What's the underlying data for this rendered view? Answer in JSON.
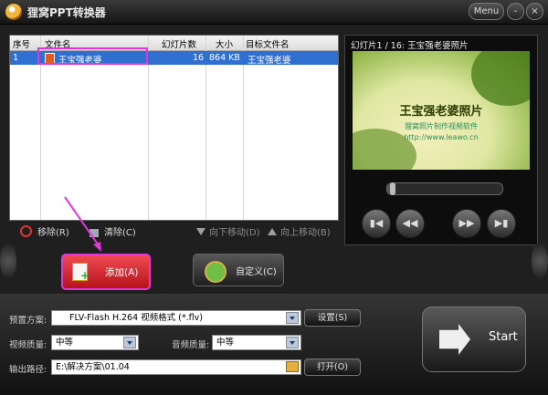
{
  "window": {
    "title": "狸窝PPT转换器",
    "menu_label": "Menu",
    "minimize_label": "-",
    "close_label": "×"
  },
  "file_table": {
    "headers": [
      "序号",
      "文件名",
      "幻灯片数",
      "大小",
      "目标文件名"
    ],
    "rows": [
      {
        "index": "1",
        "filename": "王宝强老婆",
        "slides": "16",
        "size": "864 KB",
        "target": "王宝强老婆"
      }
    ]
  },
  "preview": {
    "caption": "幻灯片1 / 16: 王宝强老婆照片",
    "slide_title": "王宝强老婆照片",
    "slide_subtitle": "狸窝照片制作视频软件",
    "slide_url": "http://www.leawo.cn",
    "progress_fraction": 0.03
  },
  "list_actions": {
    "remove": "移除(R)",
    "clear": "清除(C)",
    "move_down": "向下移动(D)",
    "move_up": "向上移动(B)"
  },
  "buttons": {
    "add": "添加(A)",
    "custom": "自定义(C)",
    "settings": "设置(S)",
    "open": "打开(O)",
    "start": "Start"
  },
  "settings": {
    "preset_label": "预置方案:",
    "preset_value": "FLV-Flash H.264 视频格式 (*.flv)",
    "video_quality_label": "视频质量:",
    "video_quality_value": "中等",
    "audio_quality_label": "音频质量:",
    "audio_quality_value": "中等",
    "output_path_label": "输出路径:",
    "output_path_value": "E:\\解决方案\\01.04"
  }
}
